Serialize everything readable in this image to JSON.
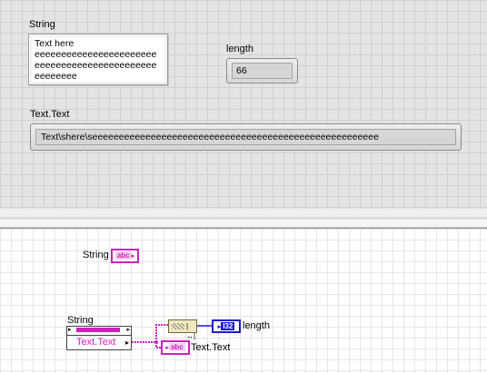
{
  "front_panel": {
    "string_control": {
      "label": "String",
      "value": "Text here\neeeeeeeeeeeeeeeeeeeeeeeeeeeeeeeeeeeeeeeeeeeeeeeeeeeeee"
    },
    "length_indicator": {
      "label": "length",
      "value": "66"
    },
    "text_indicator": {
      "label": "Text.Text",
      "value": "Text\\shere\\seeeeeeeeeeeeeeeeeeeeeeeeeeeeeeeeeeeeeeeeeeeeeeeeeeeeee"
    }
  },
  "block_diagram": {
    "string_terminal": {
      "label": "String",
      "tag": "abc"
    },
    "property_node": {
      "label": "String",
      "property": "Text.Text"
    },
    "length_terminal": {
      "tag": "I32",
      "label": "length"
    },
    "text_terminal": {
      "tag": "abc",
      "label": "Text.Text"
    }
  },
  "colors": {
    "string_wire": "#d020c0",
    "numeric_wire": "#1a1ad0"
  }
}
